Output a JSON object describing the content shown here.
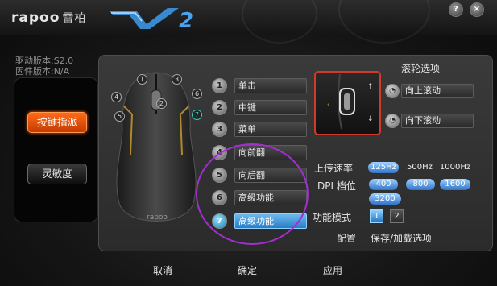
{
  "window": {
    "brand": "rapoo",
    "brand_cn": "雷柏",
    "product_logo": "V2",
    "help_label": "?",
    "close_label": "×"
  },
  "info": {
    "driver_version": "驱动版本:S2.0",
    "firmware_version": "固件版本:N/A"
  },
  "nav": {
    "assign": "按键指派",
    "sensitivity": "灵敏度"
  },
  "mouse_callouts": [
    "1",
    "2",
    "3",
    "4",
    "5",
    "6",
    "7"
  ],
  "mouse_logo": "rapoo",
  "buttons": [
    {
      "num": "1",
      "label": "单击"
    },
    {
      "num": "2",
      "label": "中键"
    },
    {
      "num": "3",
      "label": "菜单"
    },
    {
      "num": "4",
      "label": "向前翻"
    },
    {
      "num": "5",
      "label": "向后翻"
    },
    {
      "num": "6",
      "label": "高级功能"
    },
    {
      "num": "7",
      "label": "高级功能"
    }
  ],
  "selected_button": "7",
  "scroll": {
    "title": "滚轮选项",
    "up": "向上滚动",
    "down": "向下滚动"
  },
  "settings": {
    "report_rate_label": "上传速率",
    "report_rates": [
      "125Hz",
      "500Hz",
      "1000Hz"
    ],
    "report_rate_selected": "125Hz",
    "dpi_label": "DPI 档位",
    "dpi_values": [
      "400",
      "800",
      "1600",
      "3200"
    ],
    "mode_label": "功能模式",
    "modes": [
      "1",
      "2"
    ],
    "mode_selected": "1",
    "config_label": "配置",
    "config_action": "保存/加载选项"
  },
  "footer": {
    "cancel": "取消",
    "ok": "确定",
    "apply": "应用"
  },
  "colors": {
    "accent_orange": "#ff6a1a",
    "accent_blue": "#2f73c8",
    "highlight_purple": "#a22fd0",
    "scroll_border_red": "#d03a2a"
  }
}
